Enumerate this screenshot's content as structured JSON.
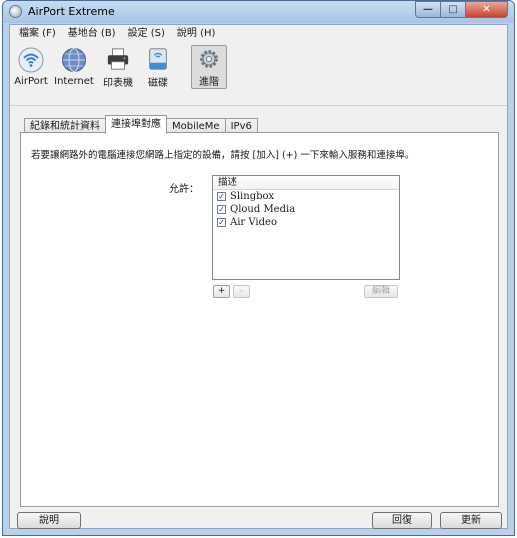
{
  "window": {
    "title": "AirPort Extreme",
    "minimize_icon": "minimize-icon",
    "maximize_icon": "maximize-icon",
    "close_icon": "close-icon"
  },
  "menubar": [
    "檔案 (F)",
    "基地台 (B)",
    "設定 (S)",
    "說明 (H)"
  ],
  "toolbar": [
    {
      "label": "AirPort",
      "icon": "wifi-icon"
    },
    {
      "label": "Internet",
      "icon": "globe-icon"
    },
    {
      "label": "印表機",
      "icon": "printer-icon"
    },
    {
      "label": "磁碟",
      "icon": "disk-icon"
    },
    {
      "label": "進階",
      "icon": "gear-icon",
      "selected": true
    }
  ],
  "tabs": [
    {
      "label": "紀錄和統計資料",
      "active": false
    },
    {
      "label": "連接埠對應",
      "active": true
    },
    {
      "label": "MobileMe",
      "active": false
    },
    {
      "label": "IPv6",
      "active": false
    }
  ],
  "panel": {
    "info": "若要讓網路外的電腦連接您網路上指定的設備，請按 [加入] (+) 一下來輸入服務和連接埠。",
    "allow_label": "允許：",
    "list_header": "描述",
    "items": [
      {
        "label": "Slingbox",
        "checked": true
      },
      {
        "label": "Qloud Media",
        "checked": true
      },
      {
        "label": "Air Video",
        "checked": true
      }
    ],
    "add_label": "+",
    "remove_label": "-",
    "edit_label": "編輯"
  },
  "footer": {
    "help_label": "說明",
    "revert_label": "回復",
    "update_label": "更新"
  },
  "colors": {
    "titlebar": "#b9d1ea",
    "close_button": "#c8432d",
    "window_bg": "#f0f0f0"
  }
}
